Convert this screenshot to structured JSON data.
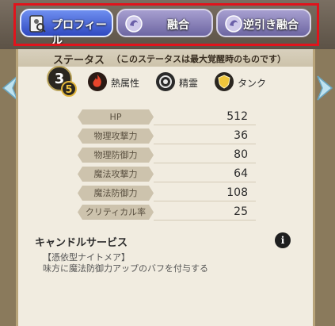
{
  "tabs": {
    "profile": "プロフィール",
    "fusion": "融合",
    "reverse": "逆引き融合"
  },
  "status": {
    "title": "ステータス",
    "note": "（このステータスは最大覚醒時のものです）",
    "rank": "3",
    "stars": "5",
    "attribute": "熱属性",
    "race": "精霊",
    "role": "タンク"
  },
  "stats": [
    {
      "name": "HP",
      "value": "512"
    },
    {
      "name": "物理攻撃力",
      "value": "36"
    },
    {
      "name": "物理防御力",
      "value": "80"
    },
    {
      "name": "魔法攻撃力",
      "value": "64"
    },
    {
      "name": "魔法防御力",
      "value": "108"
    },
    {
      "name": "クリティカル率",
      "value": "25"
    }
  ],
  "skill": {
    "name": "キャンドルサービス",
    "type": "【憑依型ナイトメア】",
    "description": "味方に魔法防御力アップのバフを付与する",
    "info": "i"
  },
  "colors": {
    "highlight": "#e0141c",
    "active_tab": "#3f5ad8",
    "inactive_tab": "#8b84b8",
    "panel": "#f1ece0"
  }
}
